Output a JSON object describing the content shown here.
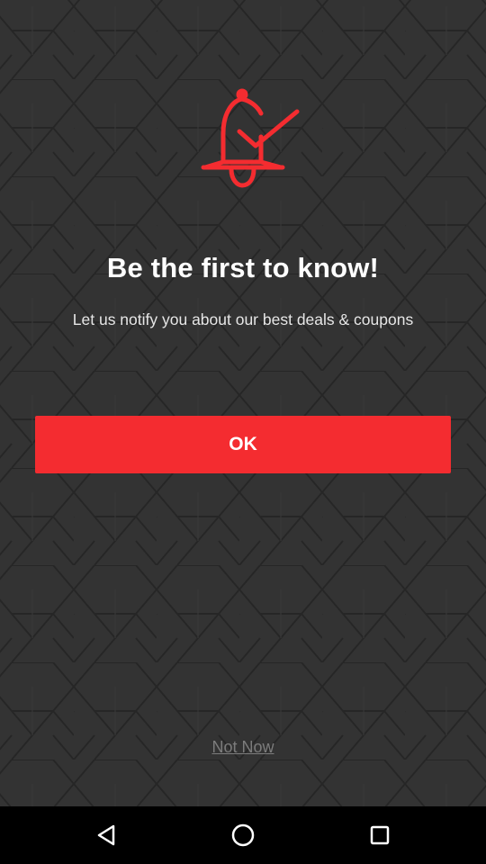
{
  "dialog": {
    "icon": "bell-check-icon",
    "title": "Be the first to know!",
    "subtitle": "Let us notify you about our best deals & coupons",
    "ok_label": "OK",
    "not_now_label": "Not Now"
  },
  "navbar": {
    "back_icon": "back-triangle-icon",
    "home_icon": "home-circle-icon",
    "recents_icon": "recents-square-icon"
  },
  "colors": {
    "accent": "#f42c30",
    "background": "#333333",
    "navbar": "#000000"
  }
}
